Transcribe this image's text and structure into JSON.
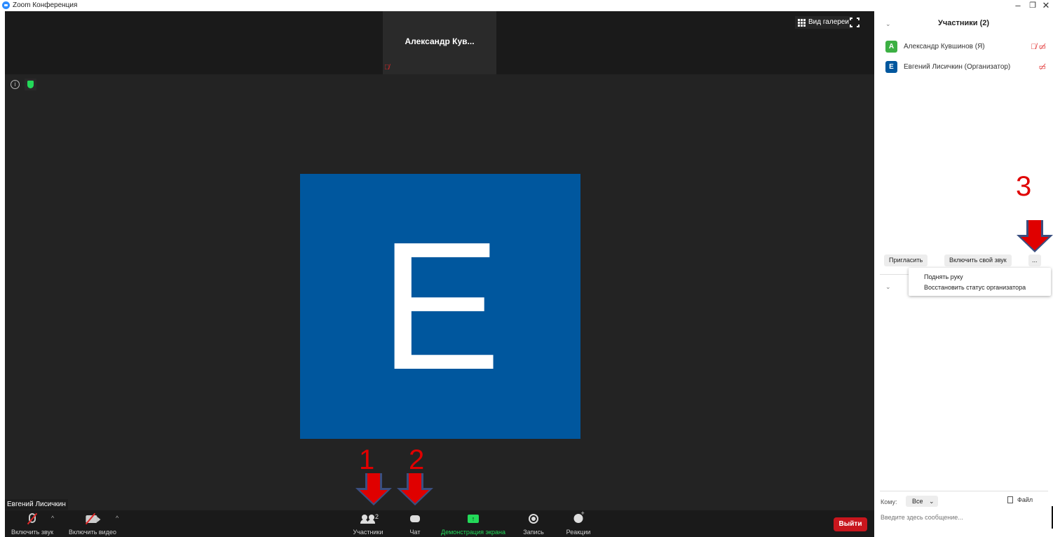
{
  "window": {
    "title": "Zoom Конференция",
    "controls": [
      "–",
      "❐",
      "✕"
    ]
  },
  "video": {
    "top_strip_participant": "Александр Кув...",
    "gallery_view_label": "Вид галереи",
    "active_speaker_initial": "E",
    "active_speaker_name": "Евгений Лисичкин"
  },
  "toolbar": {
    "unmute_label": "Включить звук",
    "start_video_label": "Включить видео",
    "participants_label": "Участники",
    "participants_count": "2",
    "chat_label": "Чат",
    "share_label": "Демонстрация экрана",
    "record_label": "Запись",
    "reactions_label": "Реакции",
    "leave_label": "Выйти"
  },
  "annotations": {
    "marker_1": "1",
    "marker_2": "2",
    "marker_3": "3"
  },
  "panel": {
    "title": "Участники (2)",
    "participants": [
      {
        "initial": "A",
        "name": "Александр Кувшинов (Я)",
        "color": "#3cb043"
      },
      {
        "initial": "E",
        "name": "Евгений Лисичкин (Организатор)",
        "color": "#00579e"
      }
    ],
    "invite_label": "Пригласить",
    "unmute_self_label": "Включить свой звук",
    "more_label": "...",
    "menu": {
      "raise_hand": "Поднять руку",
      "reclaim_host": "Восстановить статус организатора"
    },
    "chat": {
      "to_label": "Кому:",
      "to_value": "Все",
      "file_label": "Файл",
      "placeholder": "Введите здесь сообщение..."
    }
  },
  "colors": {
    "accent_green": "#23d959",
    "leave_red": "#c8161d",
    "avatar_blue": "#00579e"
  }
}
